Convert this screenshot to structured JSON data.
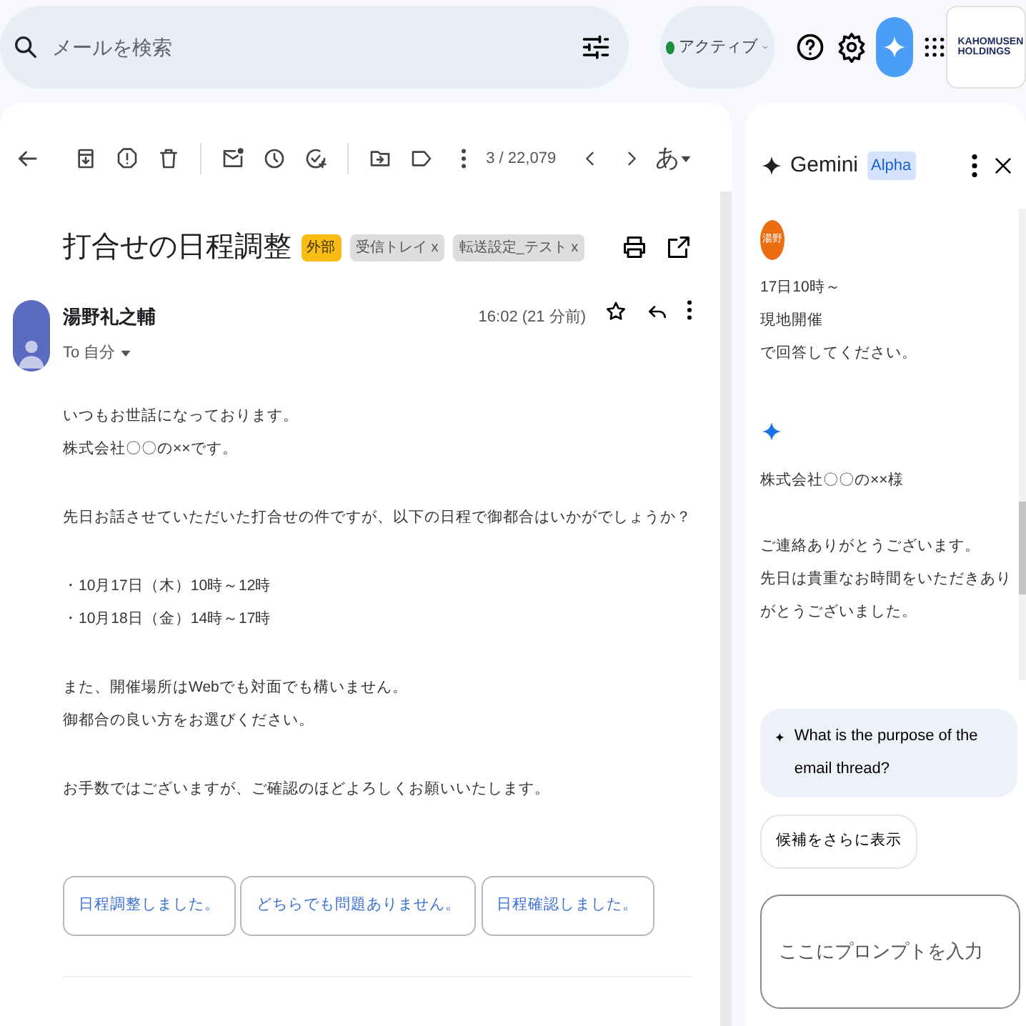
{
  "search": {
    "placeholder": "メールを検索"
  },
  "status": {
    "label": "アクティブ",
    "online": true
  },
  "account": {
    "logo_line_1": "KAHOMUSEN",
    "logo_line_2": "HOLDINGS"
  },
  "toolbar": {
    "counter": "3 / 22,079",
    "input_tool": "あ"
  },
  "subject": "打合せの日程調整",
  "labels": [
    {
      "text": "外部",
      "kind": "tag"
    },
    {
      "text": "受信トレイ",
      "kind": "removable",
      "close": "x"
    },
    {
      "text": "転送設定_テスト",
      "kind": "removable",
      "close": "x"
    }
  ],
  "message": {
    "sender": "湯野礼之輔",
    "recipient": "To 自分",
    "time": "16:02 (21 分前)",
    "body": [
      [
        "いつもお世話になっております。",
        "株式会社〇〇の××です。"
      ],
      [
        "先日お話させていただいた打合せの件ですが、以下の日程で御都合はいかがでしょうか？"
      ],
      [
        "・10月17日（木）10時～12時",
        "・10月18日（金）14時～17時"
      ],
      [
        "また、開催場所はWebでも対面でも構いません。",
        "御都合の良い方をお選びください。"
      ],
      [
        "お手数ではございますが、ご確認のほどよろしくお願いいたします。"
      ]
    ]
  },
  "smart_replies": [
    "日程調整しました。",
    "どちらでも問題ありません。",
    "日程確認しました。"
  ],
  "gemini": {
    "title": "Gemini",
    "badge": "Alpha",
    "user_avatar": "湯野",
    "user_message": [
      "17日10時～",
      "現地開催",
      "で回答してください。"
    ],
    "reply": [
      [
        "株式会社〇〇の××様"
      ],
      [
        "ご連絡ありがとうございます。",
        "先日は貴重なお時間をいただきありがとうございました。"
      ]
    ],
    "suggestion": "What is the purpose of the email thread?",
    "more_button": "候補をさらに表示",
    "prompt": {
      "placeholder": "ここにプロンプトを入力"
    }
  }
}
